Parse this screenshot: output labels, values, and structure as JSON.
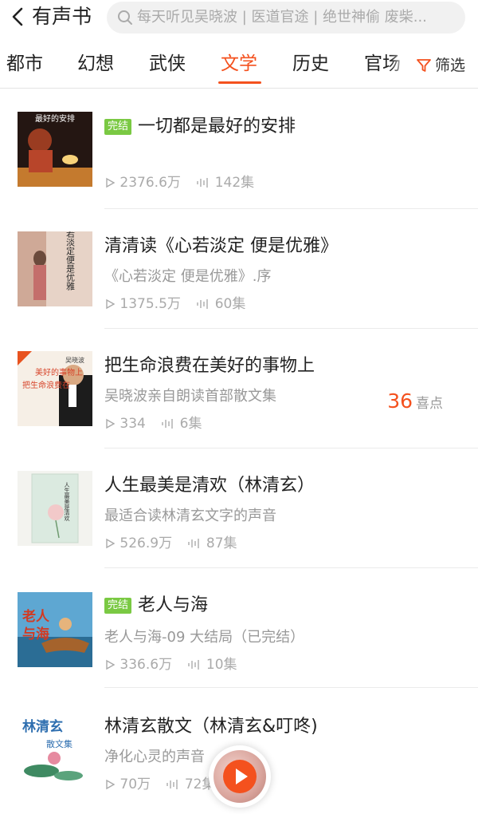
{
  "header": {
    "title": "有声书",
    "search_placeholder": "每天听见吴晓波 | 医道官途 | 绝世神偷 废柴..."
  },
  "tabs": [
    "都市",
    "幻想",
    "武侠",
    "文学",
    "历史",
    "官场"
  ],
  "active_tab": "文学",
  "filter_label": "筛选",
  "colors": {
    "accent": "#f4511e",
    "badge_green": "#7ac943",
    "muted_text": "#999999"
  },
  "books": [
    {
      "badge": "完结",
      "title": "一切都是最好的安排",
      "subtitle": "",
      "plays": "2376.6万",
      "episodes": "142集"
    },
    {
      "badge": "",
      "title": "清清读《心若淡定 便是优雅》",
      "subtitle": "《心若淡定 便是优雅》.序",
      "plays": "1375.5万",
      "episodes": "60集"
    },
    {
      "badge": "",
      "title": "把生命浪费在美好的事物上",
      "subtitle": "吴晓波亲自朗读首部散文集",
      "plays": "334",
      "episodes": "6集",
      "likes": "36",
      "likes_unit": "喜点"
    },
    {
      "badge": "",
      "title": "人生最美是清欢（林清玄）",
      "subtitle": "最适合读林清玄文字的声音",
      "plays": "526.9万",
      "episodes": "87集"
    },
    {
      "badge": "完结",
      "title": "老人与海",
      "subtitle": "老人与海-09 大结局（已完结）",
      "plays": "336.6万",
      "episodes": "10集"
    },
    {
      "badge": "",
      "title": "林清玄散文（林清玄&叮咚)",
      "subtitle": "净化心灵的声音",
      "plays": "70万",
      "episodes": "72集"
    }
  ],
  "cover_art": {
    "book1": "最好的安排",
    "book2": "心若淡定便是优雅",
    "book3": [
      "美好的事物上",
      "把生命浪费在",
      "吴晓波"
    ],
    "book4": "人生最美是清欢",
    "book5": [
      "老人",
      "与海"
    ],
    "book6": [
      "林清玄",
      "散文集"
    ]
  }
}
